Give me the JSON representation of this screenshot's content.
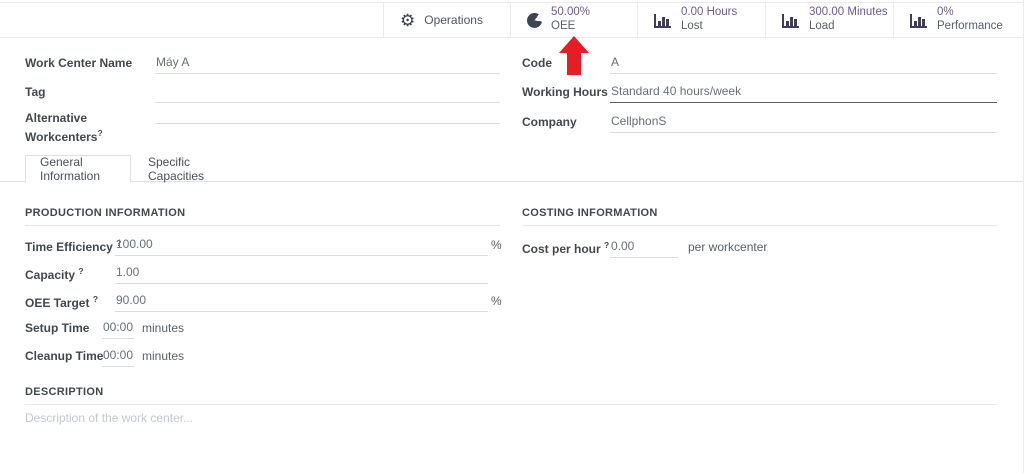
{
  "statbar": {
    "operations": {
      "label": "Operations"
    },
    "oee": {
      "value": "50.00%",
      "label": "OEE"
    },
    "lost": {
      "value": "0.00 Hours",
      "label": "Lost"
    },
    "load": {
      "value": "300.00 Minutes",
      "label": "Load"
    },
    "performance": {
      "value": "0%",
      "label": "Performance"
    },
    "value_color": "#6f5a8e"
  },
  "header_fields": {
    "work_center_name": {
      "label": "Work Center Name",
      "value": "Máy A"
    },
    "tag": {
      "label": "Tag",
      "value": ""
    },
    "alternative_workcenters": {
      "label": "Alternative Workcenters",
      "help": "?",
      "value": ""
    },
    "code": {
      "label": "Code",
      "value": "A"
    },
    "working_hours": {
      "label": "Working Hours",
      "value": "Standard 40 hours/week"
    },
    "company": {
      "label": "Company",
      "value": "CellphonS"
    }
  },
  "tabs": {
    "general": "General Information",
    "capacities": "Specific Capacities"
  },
  "production": {
    "title": "PRODUCTION INFORMATION",
    "time_efficiency": {
      "label": "Time Efficiency",
      "help": "?",
      "value": "100.00",
      "suffix": "%"
    },
    "capacity": {
      "label": "Capacity",
      "help": "?",
      "value": "1.00"
    },
    "oee_target": {
      "label": "OEE Target",
      "help": "?",
      "value": "90.00",
      "suffix": "%"
    },
    "setup_time": {
      "label": "Setup Time",
      "value": "00:00",
      "suffix": "minutes"
    },
    "cleanup_time": {
      "label": "Cleanup Time",
      "value": "00:00",
      "suffix": "minutes"
    }
  },
  "costing": {
    "title": "COSTING INFORMATION",
    "cost_per_hour": {
      "label": "Cost per hour",
      "help": "?",
      "value": "0.00",
      "suffix": "per workcenter"
    }
  },
  "description": {
    "title": "DESCRIPTION",
    "placeholder": "Description of the work center..."
  },
  "annotation": {
    "arrow_color": "#e31e24"
  }
}
